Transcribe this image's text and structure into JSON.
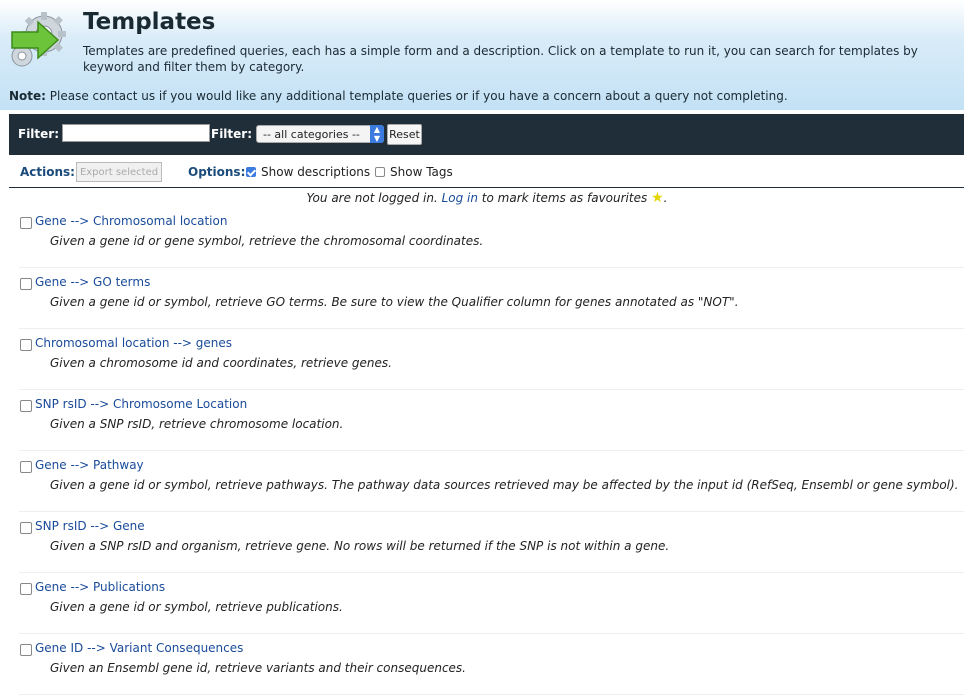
{
  "header": {
    "title": "Templates",
    "description": "Templates are predefined queries, each has a simple form and a description. Click on a template to run it, you can search for templates by keyword and filter them by category.",
    "note_label": "Note:",
    "note_text": " Please contact us if you would like any additional template queries or if you have a concern about a query not completing."
  },
  "filterbar": {
    "filter_label": "Filter:",
    "filter_value": "",
    "category_label": "Filter:",
    "category_selected": "-- all categories --",
    "reset_label": "Reset"
  },
  "actions": {
    "actions_label": "Actions:",
    "export_label": "Export selected",
    "options_label": "Options:",
    "show_descriptions_label": "Show descriptions",
    "show_descriptions_checked": true,
    "show_tags_label": "Show Tags",
    "show_tags_checked": false
  },
  "login": {
    "prefix": "You are not logged in. ",
    "link": "Log in",
    "suffix": " to mark items as favourites",
    "end": "."
  },
  "templates": [
    {
      "title": "Gene --> Chromosomal location",
      "description": "Given a gene id or gene symbol, retrieve the chromosomal coordinates."
    },
    {
      "title": "Gene --> GO terms",
      "description": "Given a gene id or symbol, retrieve GO terms. Be sure to view the Qualifier column for genes annotated as \"NOT\"."
    },
    {
      "title": "Chromosomal location --> genes",
      "description": "Given a chromosome id and coordinates, retrieve genes."
    },
    {
      "title": "SNP rsID --> Chromosome Location",
      "description": "Given a SNP rsID, retrieve chromosome location."
    },
    {
      "title": "Gene --> Pathway",
      "description": "Given a gene id or symbol, retrieve pathways. The pathway data sources retrieved may be affected by the input id (RefSeq, Ensembl or gene symbol)."
    },
    {
      "title": "SNP rsID --> Gene",
      "description": "Given a SNP rsID and organism, retrieve gene. No rows will be returned if the SNP is not within a gene."
    },
    {
      "title": "Gene --> Publications",
      "description": "Given a gene id or symbol, retrieve publications."
    },
    {
      "title": "Gene ID --> Variant Consequences",
      "description": "Given an Ensembl gene id, retrieve variants and their consequences."
    }
  ],
  "colors": {
    "header_bg": "#c3e1f5",
    "toolbar_bg": "#1f2e38",
    "link": "#1a4b9a",
    "accent": "#3b7be0"
  }
}
